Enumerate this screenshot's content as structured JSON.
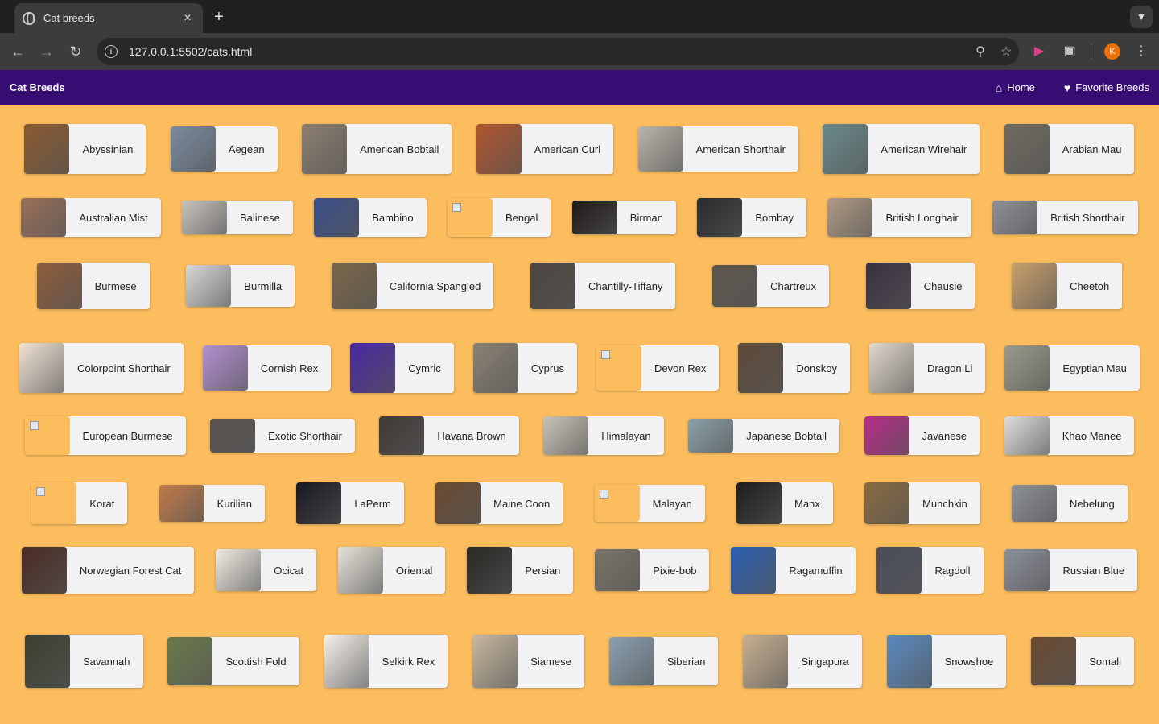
{
  "browser": {
    "tab_title": "Cat breeds",
    "tab_close": "×",
    "new_tab": "+",
    "url": "127.0.0.1:5502/cats.html",
    "avatar_letter": "K"
  },
  "navbar": {
    "brand": "Cat Breeds",
    "home": "Home",
    "favorites": "Favorite Breeds"
  },
  "breeds": [
    [
      "Abyssinian",
      "Aegean",
      "American Bobtail",
      "American Curl",
      "American Shorthair",
      "American Wirehair",
      "Arabian Mau"
    ],
    [
      "Australian Mist",
      "Balinese",
      "Bambino",
      "Bengal",
      "Birman",
      "Bombay",
      "British Longhair",
      "British Shorthair"
    ],
    [
      "Burmese",
      "Burmilla",
      "California Spangled",
      "Chantilly-Tiffany",
      "Chartreux",
      "Chausie",
      "Cheetoh"
    ],
    [
      "Colorpoint Shorthair",
      "Cornish Rex",
      "Cymric",
      "Cyprus",
      "Devon Rex",
      "Donskoy",
      "Dragon Li",
      "Egyptian Mau"
    ],
    [
      "European Burmese",
      "Exotic Shorthair",
      "Havana Brown",
      "Himalayan",
      "Japanese Bobtail",
      "Javanese",
      "Khao Manee"
    ],
    [
      "Korat",
      "Kurilian",
      "LaPerm",
      "Maine Coon",
      "Malayan",
      "Manx",
      "Munchkin",
      "Nebelung"
    ],
    [
      "Norwegian Forest Cat",
      "Ocicat",
      "Oriental",
      "Persian",
      "Pixie-bob",
      "Ragamuffin",
      "Ragdoll",
      "Russian Blue"
    ],
    [
      "Savannah",
      "Scottish Fold",
      "Selkirk Rex",
      "Siamese",
      "Siberian",
      "Singapura",
      "Snowshoe",
      "Somali"
    ]
  ],
  "thumb_colors": [
    [
      "#8a5a30",
      "#7a8aa0",
      "#8c7f70",
      "#b0552e",
      "#b9b4aa",
      "#6a8a8a",
      "#6f6a60"
    ],
    [
      "#9a7058",
      "#c7c2bd",
      "#3a4f8a",
      "broken",
      "#1e1a18",
      "#2a2a2a",
      "#b09a84",
      "#8f8f98"
    ],
    [
      "#8d5c3a",
      "#d8d8d8",
      "#7a6648",
      "#4d4540",
      "#5d564e",
      "#3a3040",
      "#c8a06a"
    ],
    [
      "#f0e2d4",
      "#b28fd0",
      "#4a28a0",
      "#8a8274",
      "broken",
      "#5e4a3a",
      "#e0d8cc",
      "#9a9a8a"
    ],
    [
      "broken",
      "#5a5550",
      "#3f3a36",
      "#c8c2b8",
      "#8aa0a8",
      "#b82c8a",
      "#dedede"
    ],
    [
      "broken",
      "#c07a48",
      "#181820",
      "#6a4a30",
      "broken",
      "#1e1e1e",
      "#8a6a40",
      "#8c9096"
    ],
    [
      "#4a2a22",
      "#f0ece4",
      "#e6e2da",
      "#2a2824",
      "#7a7468",
      "#2a60b0",
      "#4a4e5a",
      "#8a8f98"
    ],
    [
      "#3a4030",
      "#6a7a4a",
      "#f4f0ea",
      "#c8b8a0",
      "#8aa0b0",
      "#c8b090",
      "#5a8ac0",
      "#6a4a30"
    ]
  ]
}
